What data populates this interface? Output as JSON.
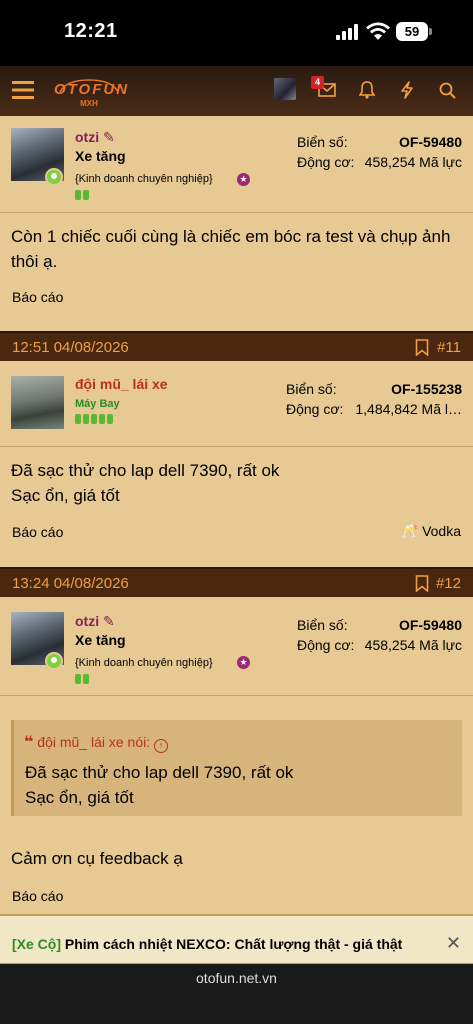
{
  "status_bar": {
    "time": "12:21",
    "battery": "59"
  },
  "navbar": {
    "logo_text": "OTOFUN",
    "logo_sub": "MXH",
    "inbox_badge": "4"
  },
  "posts": [
    {
      "user": {
        "name": "otzi",
        "title": "Xe tăng",
        "rank": "{Kinh doanh chuyên nghiệp}"
      },
      "stats": {
        "plate_label": "Biển số:",
        "plate_value": "OF-59480",
        "engine_label": "Động cơ:",
        "engine_value": "458,254 Mã lực"
      },
      "body": "Còn 1 chiếc cuối cùng là chiếc em bóc ra test và chụp ảnh thôi ạ.",
      "report": "Báo cáo"
    },
    {
      "date": "12:51 04/08/2026",
      "number": "#11",
      "user": {
        "name": "đội mũ_ lái xe",
        "title": "Máy Bay"
      },
      "stats": {
        "plate_label": "Biển số:",
        "plate_value": "OF-155238",
        "engine_label": "Động cơ:",
        "engine_value": "1,484,842 Mã l…"
      },
      "body_lines": [
        "Đã sạc thử cho lap dell 7390, rất ok",
        "Sạc ổn, giá tốt"
      ],
      "report": "Báo cáo",
      "reaction": "Vodka"
    },
    {
      "date": "13:24 04/08/2026",
      "number": "#12",
      "user": {
        "name": "otzi",
        "title": "Xe tăng",
        "rank": "{Kinh doanh chuyên nghiệp}"
      },
      "stats": {
        "plate_label": "Biển số:",
        "plate_value": "OF-59480",
        "engine_label": "Động cơ:",
        "engine_value": "458,254 Mã lực"
      },
      "quote": {
        "author": "đội mũ_ lái xe nói:",
        "lines": [
          "Đã sạc thử cho lap dell 7390, rất ok",
          "Sạc ổn, giá tốt"
        ]
      },
      "body": "Cảm ơn cụ feedback ạ",
      "report": "Báo cáo"
    }
  ],
  "banner": {
    "tag": "[Xe Cộ]",
    "text": "Phim cách nhiệt NEXCO: Chất lượng thật - giá thật"
  },
  "browser": {
    "url": "otofun.net.vn"
  },
  "colors": {
    "header_bg": "#4a2810",
    "post_bg": "#e7c993",
    "accent": "#f0a040",
    "username": "#8a1f5e"
  }
}
